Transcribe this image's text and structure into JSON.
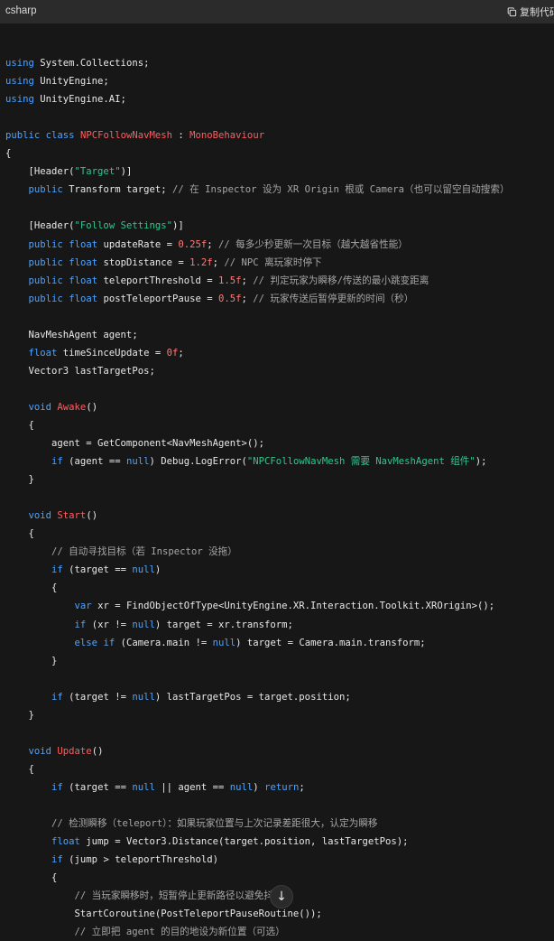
{
  "header": {
    "language": "csharp",
    "copy_label": "复制代码"
  },
  "code_lines": [
    [],
    [
      [
        "k",
        "using"
      ],
      [
        "p",
        " System.Collections;"
      ]
    ],
    [
      [
        "k",
        "using"
      ],
      [
        "p",
        " UnityEngine;"
      ]
    ],
    [
      [
        "k",
        "using"
      ],
      [
        "p",
        " UnityEngine.AI;"
      ]
    ],
    [],
    [
      [
        "k",
        "public"
      ],
      [
        "p",
        " "
      ],
      [
        "k",
        "class"
      ],
      [
        "p",
        " "
      ],
      [
        "cls",
        "NPCFollowNavMesh"
      ],
      [
        "p",
        " : "
      ],
      [
        "cls",
        "MonoBehaviour"
      ]
    ],
    [
      [
        "p",
        "{"
      ]
    ],
    [
      [
        "p",
        "    [Header("
      ],
      [
        "s",
        "\"Target\""
      ],
      [
        "p",
        ")]"
      ]
    ],
    [
      [
        "p",
        "    "
      ],
      [
        "k",
        "public"
      ],
      [
        "p",
        " Transform target; "
      ],
      [
        "c",
        "// 在 Inspector 设为 XR Origin 根或 Camera（也可以留空自动搜索）"
      ]
    ],
    [],
    [
      [
        "p",
        "    [Header("
      ],
      [
        "s",
        "\"Follow Settings\""
      ],
      [
        "p",
        ")]"
      ]
    ],
    [
      [
        "p",
        "    "
      ],
      [
        "k",
        "public"
      ],
      [
        "p",
        " "
      ],
      [
        "k",
        "float"
      ],
      [
        "p",
        " updateRate = "
      ],
      [
        "n",
        "0.25f"
      ],
      [
        "p",
        "; "
      ],
      [
        "c",
        "// 每多少秒更新一次目标（越大越省性能）"
      ]
    ],
    [
      [
        "p",
        "    "
      ],
      [
        "k",
        "public"
      ],
      [
        "p",
        " "
      ],
      [
        "k",
        "float"
      ],
      [
        "p",
        " stopDistance = "
      ],
      [
        "n",
        "1.2f"
      ],
      [
        "p",
        "; "
      ],
      [
        "c",
        "// NPC 离玩家时停下"
      ]
    ],
    [
      [
        "p",
        "    "
      ],
      [
        "k",
        "public"
      ],
      [
        "p",
        " "
      ],
      [
        "k",
        "float"
      ],
      [
        "p",
        " teleportThreshold = "
      ],
      [
        "n",
        "1.5f"
      ],
      [
        "p",
        "; "
      ],
      [
        "c",
        "// 判定玩家为瞬移/传送的最小跳变距离"
      ]
    ],
    [
      [
        "p",
        "    "
      ],
      [
        "k",
        "public"
      ],
      [
        "p",
        " "
      ],
      [
        "k",
        "float"
      ],
      [
        "p",
        " postTeleportPause = "
      ],
      [
        "n",
        "0.5f"
      ],
      [
        "p",
        "; "
      ],
      [
        "c",
        "// 玩家传送后暂停更新的时间（秒）"
      ]
    ],
    [],
    [
      [
        "p",
        "    NavMeshAgent agent;"
      ]
    ],
    [
      [
        "p",
        "    "
      ],
      [
        "k",
        "float"
      ],
      [
        "p",
        " timeSinceUpdate = "
      ],
      [
        "n",
        "0f"
      ],
      [
        "p",
        ";"
      ]
    ],
    [
      [
        "p",
        "    Vector3 lastTargetPos;"
      ]
    ],
    [],
    [
      [
        "p",
        "    "
      ],
      [
        "k",
        "void"
      ],
      [
        "p",
        " "
      ],
      [
        "fn",
        "Awake"
      ],
      [
        "p",
        "()"
      ]
    ],
    [
      [
        "p",
        "    {"
      ]
    ],
    [
      [
        "p",
        "        agent = GetComponent<NavMeshAgent>();"
      ]
    ],
    [
      [
        "p",
        "        "
      ],
      [
        "k",
        "if"
      ],
      [
        "p",
        " (agent == "
      ],
      [
        "k",
        "null"
      ],
      [
        "p",
        ") Debug.LogError("
      ],
      [
        "s",
        "\"NPCFollowNavMesh 需要 NavMeshAgent 组件\""
      ],
      [
        "p",
        ");"
      ]
    ],
    [
      [
        "p",
        "    }"
      ]
    ],
    [],
    [
      [
        "p",
        "    "
      ],
      [
        "k",
        "void"
      ],
      [
        "p",
        " "
      ],
      [
        "fn",
        "Start"
      ],
      [
        "p",
        "()"
      ]
    ],
    [
      [
        "p",
        "    {"
      ]
    ],
    [
      [
        "p",
        "        "
      ],
      [
        "c",
        "// 自动寻找目标（若 Inspector 没拖）"
      ]
    ],
    [
      [
        "p",
        "        "
      ],
      [
        "k",
        "if"
      ],
      [
        "p",
        " (target == "
      ],
      [
        "k",
        "null"
      ],
      [
        "p",
        ")"
      ]
    ],
    [
      [
        "p",
        "        {"
      ]
    ],
    [
      [
        "p",
        "            "
      ],
      [
        "k",
        "var"
      ],
      [
        "p",
        " xr = FindObjectOfType<UnityEngine.XR.Interaction.Toolkit.XROrigin>();"
      ]
    ],
    [
      [
        "p",
        "            "
      ],
      [
        "k",
        "if"
      ],
      [
        "p",
        " (xr != "
      ],
      [
        "k",
        "null"
      ],
      [
        "p",
        ") target = xr.transform;"
      ]
    ],
    [
      [
        "p",
        "            "
      ],
      [
        "k",
        "else"
      ],
      [
        "p",
        " "
      ],
      [
        "k",
        "if"
      ],
      [
        "p",
        " (Camera.main != "
      ],
      [
        "k",
        "null"
      ],
      [
        "p",
        ") target = Camera.main.transform;"
      ]
    ],
    [
      [
        "p",
        "        }"
      ]
    ],
    [],
    [
      [
        "p",
        "        "
      ],
      [
        "k",
        "if"
      ],
      [
        "p",
        " (target != "
      ],
      [
        "k",
        "null"
      ],
      [
        "p",
        ") lastTargetPos = target.position;"
      ]
    ],
    [
      [
        "p",
        "    }"
      ]
    ],
    [],
    [
      [
        "p",
        "    "
      ],
      [
        "k",
        "void"
      ],
      [
        "p",
        " "
      ],
      [
        "fn",
        "Update"
      ],
      [
        "p",
        "()"
      ]
    ],
    [
      [
        "p",
        "    {"
      ]
    ],
    [
      [
        "p",
        "        "
      ],
      [
        "k",
        "if"
      ],
      [
        "p",
        " (target == "
      ],
      [
        "k",
        "null"
      ],
      [
        "p",
        " || agent == "
      ],
      [
        "k",
        "null"
      ],
      [
        "p",
        ") "
      ],
      [
        "k",
        "return"
      ],
      [
        "p",
        ";"
      ]
    ],
    [],
    [
      [
        "p",
        "        "
      ],
      [
        "c",
        "// 检测瞬移（teleport）：如果玩家位置与上次记录差距很大，认定为瞬移"
      ]
    ],
    [
      [
        "p",
        "        "
      ],
      [
        "k",
        "float"
      ],
      [
        "p",
        " jump = Vector3.Distance(target.position, lastTargetPos);"
      ]
    ],
    [
      [
        "p",
        "        "
      ],
      [
        "k",
        "if"
      ],
      [
        "p",
        " (jump > teleportThreshold)"
      ]
    ],
    [
      [
        "p",
        "        {"
      ]
    ],
    [
      [
        "p",
        "            "
      ],
      [
        "c",
        "// 当玩家瞬移时，短暂停止更新路径以避免抖动"
      ]
    ],
    [
      [
        "p",
        "            StartCoroutine(PostTeleportPauseRoutine());"
      ]
    ],
    [
      [
        "p",
        "            "
      ],
      [
        "c",
        "// 立即把 agent 的目的地设为新位置（可选）"
      ]
    ]
  ],
  "scroll_button": {
    "icon": "arrow-down-icon",
    "glyph": "↓"
  }
}
